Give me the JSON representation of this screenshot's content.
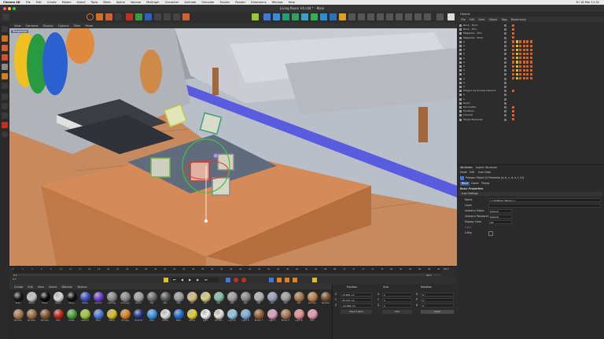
{
  "menubar": {
    "apple": "",
    "app": "Cinema 4D",
    "items": [
      "File",
      "Edit",
      "Create",
      "Modes",
      "Select",
      "Tools",
      "Mesh",
      "Spline",
      "Volume",
      "MoGraph",
      "Character",
      "Animate",
      "Simulate",
      "Tracker",
      "Render",
      "Extensions",
      "Window",
      "Help"
    ],
    "clock": "Fri 18 Mar 11:31"
  },
  "titlebar": {
    "title": "Living Room V4.c4d * - Main"
  },
  "toolbar": {
    "node_spaces": "Node Spaces",
    "layout": "Layouts"
  },
  "viewport": {
    "menu": [
      "View",
      "Cameras",
      "Display",
      "Options",
      "Filter",
      "Panel"
    ],
    "hud": "Perspective"
  },
  "timeline": {
    "ticks": [
      "0",
      "2",
      "4",
      "6",
      "8",
      "10",
      "12",
      "14",
      "16",
      "18",
      "20",
      "22",
      "24",
      "26",
      "28",
      "30",
      "32",
      "34",
      "36",
      "38",
      "40",
      "42",
      "44",
      "46",
      "48",
      "50",
      "52",
      "54",
      "56",
      "58",
      "60",
      "62",
      "64",
      "66",
      "68",
      "70",
      "72",
      "74",
      "76",
      "78",
      "80",
      "82",
      "84",
      "86",
      "88",
      "90"
    ],
    "start": "0 F",
    "current": "0 F",
    "end": "90 F",
    "end2": "90 F"
  },
  "materials": {
    "menu": [
      "Create",
      "Edit",
      "View",
      "Select",
      "Material",
      "Texture"
    ],
    "items": [
      {
        "name": "Paint",
        "color": "#1a1a1a"
      },
      {
        "name": "Metal",
        "color": "#c8c8c8"
      },
      {
        "name": "Black",
        "color": "#0c0c0c"
      },
      {
        "name": "Black",
        "color": "#d8d8d8"
      },
      {
        "name": "Shiny",
        "color": "#111111"
      },
      {
        "name": "Matte",
        "color": "#3a52c8"
      },
      {
        "name": "Upload",
        "color": "#6a3ed0"
      },
      {
        "name": "Catchlig",
        "color": "#8a8a8a"
      },
      {
        "name": "Cactusgr",
        "color": "#8a8a8a"
      },
      {
        "name": "Fabric",
        "color": "#a0a0a0"
      },
      {
        "name": "Mat",
        "color": "#6e6e6e"
      },
      {
        "name": "Mat",
        "color": "#585858"
      },
      {
        "name": "Mat",
        "color": "#9a9a9a"
      },
      {
        "name": "Mat",
        "color": "#d8c080"
      },
      {
        "name": "Mat",
        "color": "#d8d080"
      },
      {
        "name": "Mat",
        "color": "#80c0a0"
      },
      {
        "name": "Mat",
        "color": "#a0a0a0"
      },
      {
        "name": "Mat",
        "color": "#8a8a8a"
      },
      {
        "name": "Mat",
        "color": "#b0b0b0"
      },
      {
        "name": "Mat",
        "color": "#9aa0c0"
      },
      {
        "name": "Mat",
        "color": "#a0a0a0"
      },
      {
        "name": "Mat",
        "color": "#a87848"
      },
      {
        "name": "Wooden",
        "color": "#c08048"
      },
      {
        "name": "Wooden",
        "color": "#7a4e2a"
      },
      {
        "name": "Wooden",
        "color": "#b07a4a"
      },
      {
        "name": "Wooden",
        "color": "#a07040"
      },
      {
        "name": "Wooden",
        "color": "#8a5a30"
      },
      {
        "name": "Red",
        "color": "#c02818"
      },
      {
        "name": "Green",
        "color": "#4aa838"
      },
      {
        "name": "Green P",
        "color": "#9ad030"
      },
      {
        "name": "Blue",
        "color": "#4878e0"
      },
      {
        "name": "Yellow",
        "color": "#d8c020"
      },
      {
        "name": "Orange",
        "color": "#e08020"
      },
      {
        "name": "Dark Bl",
        "color": "#203888"
      },
      {
        "name": "Blue",
        "color": "#3a98e8"
      },
      {
        "name": "White",
        "color": "#e0e0e0"
      },
      {
        "name": "Blue",
        "color": "#2070d8"
      },
      {
        "name": "Yellow",
        "color": "#e8d030"
      },
      {
        "name": "Light",
        "color": "#f0f0f0"
      },
      {
        "name": "Off Whi",
        "color": "#e8e4d8"
      },
      {
        "name": "Light B",
        "color": "#90c8e8"
      },
      {
        "name": "Light B",
        "color": "#78b0e0"
      },
      {
        "name": "Brown F",
        "color": "#9a6030"
      },
      {
        "name": "Light P",
        "color": "#e0a0c0"
      },
      {
        "name": "Brown F",
        "color": "#b07850"
      },
      {
        "name": "Light B",
        "color": "#e89090"
      },
      {
        "name": "Pink",
        "color": "#e898b0"
      }
    ]
  },
  "coordinates": {
    "headers": [
      "Position",
      "Size",
      "Rotation"
    ],
    "rows": [
      {
        "axis": "X",
        "pos": "19.881 cm",
        "size": "1",
        "rot_axis": "H",
        "rot": "0 °"
      },
      {
        "axis": "Y",
        "pos": "45.797 cm",
        "size": "1",
        "rot_axis": "P",
        "rot": "0 °"
      },
      {
        "axis": "Z",
        "pos": "-24.684 cm",
        "size": "1",
        "rot_axis": "B",
        "rot": "0 °"
      }
    ],
    "mode": "Object (Rel)",
    "size_mode": "Size",
    "apply": "Apply"
  },
  "objects": {
    "menu": [
      "File",
      "Edit",
      "View",
      "Object",
      "Tags",
      "Bookmarks"
    ],
    "header": "Objects",
    "rows": [
      {
        "name": "Book - Thick",
        "tags": [
          "#e06020"
        ]
      },
      {
        "name": "Book - Thin",
        "tags": [
          "#e06020"
        ]
      },
      {
        "name": "Magazine - Thin",
        "tags": [
          "#e06020"
        ]
      },
      {
        "name": "Magazine - Thick",
        "tags": [
          "#e06020"
        ]
      },
      {
        "name": "A",
        "tags": [
          "#e06020",
          "#d8c020",
          "#e06020",
          "#e06020",
          "#e06020",
          "#e06020"
        ]
      },
      {
        "name": "A",
        "tags": [
          "#e06020",
          "#d8c020",
          "#e06020",
          "#e06020",
          "#e06020",
          "#e06020"
        ]
      },
      {
        "name": "A",
        "tags": [
          "#e06020",
          "#d8c020",
          "#e06020",
          "#e06020",
          "#e06020",
          "#e06020"
        ]
      },
      {
        "name": "A",
        "tags": [
          "#e06020",
          "#d8c020",
          "#e06020",
          "#e06020",
          "#e06020",
          "#e06020"
        ]
      },
      {
        "name": "A",
        "tags": [
          "#e06020",
          "#d8c020",
          "#e06020",
          "#e06020",
          "#e06020",
          "#e06020"
        ]
      },
      {
        "name": "A",
        "tags": [
          "#e06020",
          "#d8c020",
          "#e06020",
          "#e06020",
          "#e06020",
          "#e06020"
        ]
      },
      {
        "name": "A",
        "tags": [
          "#e06020",
          "#d8c020",
          "#e06020",
          "#e06020",
          "#e06020",
          "#e06020"
        ]
      },
      {
        "name": "A",
        "tags": [
          "#e06020",
          "#d8c020",
          "#e06020",
          "#e06020",
          "#e06020",
          "#e06020"
        ]
      },
      {
        "name": "A",
        "tags": [
          "#e06020",
          "#d8c020",
          "#e06020",
          "#e06020",
          "#e06020",
          "#e06020"
        ]
      },
      {
        "name": "A",
        "tags": [
          "#e06020",
          "#d8c020",
          "#e06020",
          "#e06020",
          "#e06020",
          "#e06020"
        ]
      },
      {
        "name": "A",
        "tags": []
      },
      {
        "name": "A",
        "tags": []
      },
      {
        "name": "Polygon by Scenes Interiors",
        "tags": [
          "#e06020"
        ]
      },
      {
        "name": "A",
        "tags": []
      },
      {
        "name": "A",
        "tags": []
      },
      {
        "name": "Room",
        "tags": []
      },
      {
        "name": "Decoration",
        "tags": [
          "#e06020"
        ]
      },
      {
        "name": "Furniture",
        "tags": [
          "#e06020"
        ]
      },
      {
        "name": "Camera",
        "tags": [
          "#e06020"
        ]
      },
      {
        "name": "Studio Elements",
        "tags": [
          "#e06020"
        ]
      }
    ]
  },
  "attributes": {
    "tabs": [
      "Attributes",
      "Layers",
      "Structure"
    ],
    "menu": [
      "Mode",
      "Edit",
      "User Data"
    ],
    "title": "Polygon Object [4 Elements (a, b, c, d, e, f, h)]",
    "subtabs": [
      "Basic",
      "Coord.",
      "Phong"
    ],
    "section": "Basic Properties",
    "subsection": "Icon Settings",
    "fields": [
      {
        "label": "Name",
        "value": "<<Multiple Values>>"
      },
      {
        "label": "Layer",
        "value": ""
      },
      {
        "label": "Visible in Editor",
        "value": "Default"
      },
      {
        "label": "Visible in Renderer",
        "value": "Default"
      },
      {
        "label": "Display Color",
        "value": "Off"
      },
      {
        "label": "Color",
        "value": ""
      },
      {
        "label": "X-Ray",
        "value": ""
      }
    ]
  }
}
